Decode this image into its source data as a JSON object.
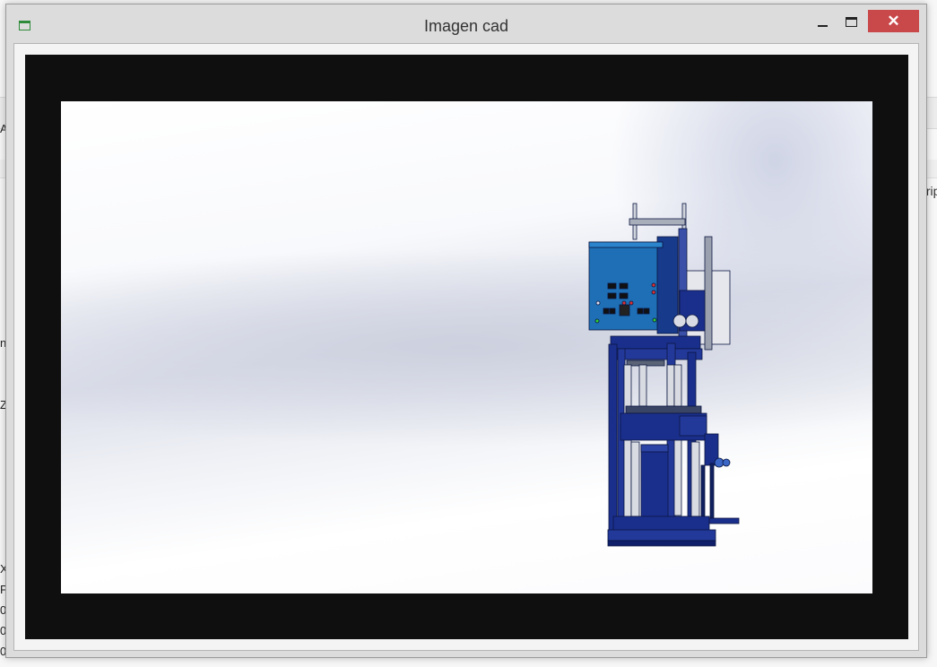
{
  "window": {
    "title": "Imagen cad",
    "close_label": "✕"
  },
  "background": {
    "right_text": "trip",
    "left_chars": [
      "Al",
      "ne",
      "Z",
      "X",
      "P",
      "0",
      "0",
      "0"
    ]
  },
  "viewport": {
    "image_description_icon": "cad-press-model"
  },
  "colors": {
    "machine_blue": "#1a2f8c",
    "panel_blue": "#1e6fb5",
    "close_red": "#c9484a"
  }
}
